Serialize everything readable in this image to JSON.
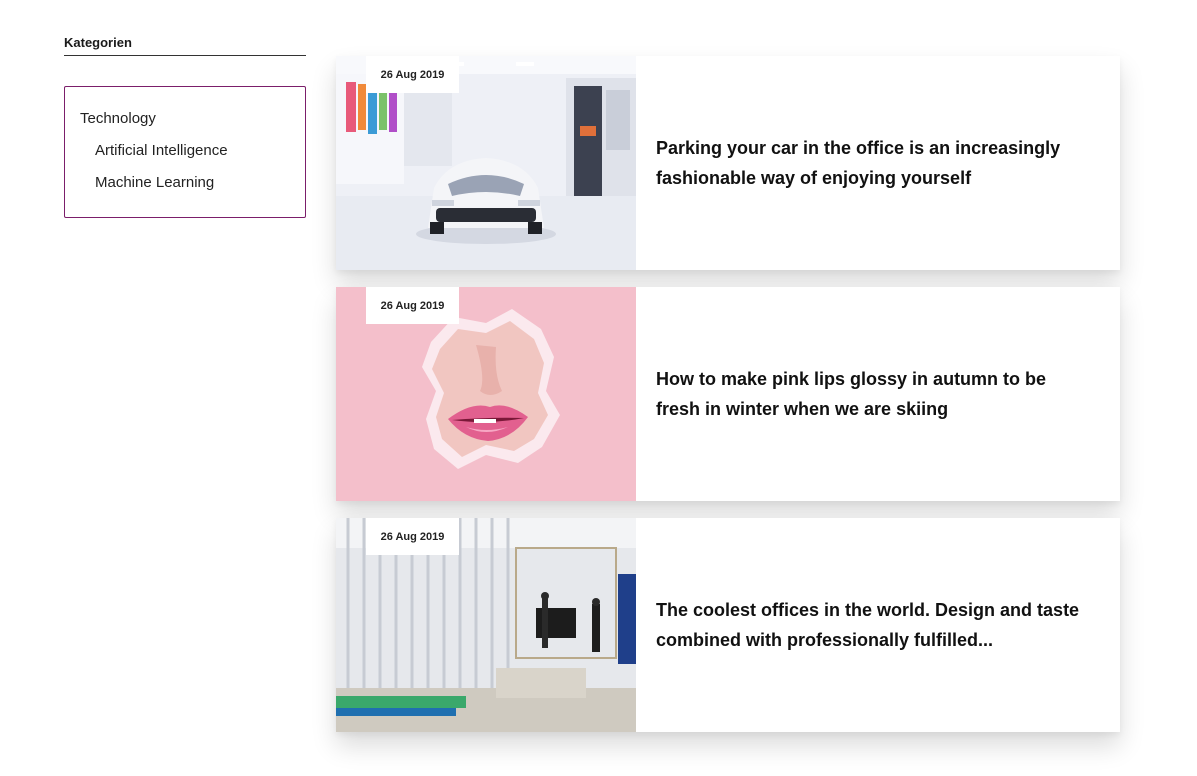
{
  "sidebar": {
    "title": "Kategorien",
    "categories": [
      {
        "label": "Technology",
        "level": 0
      },
      {
        "label": "Artificial Intelligence",
        "level": 1
      },
      {
        "label": "Machine Learning",
        "level": 1
      }
    ]
  },
  "posts": [
    {
      "date": "26 Aug 2019",
      "title": "Parking your car in the office is an increasingly fashionable way of enjoying yourself"
    },
    {
      "date": "26 Aug 2019",
      "title": "How to make pink lips glossy in autumn to be fresh in winter when we are skiing"
    },
    {
      "date": "26 Aug 2019",
      "title": "The coolest offices in the world. Design and taste combined with professionally fulfilled..."
    }
  ],
  "colors": {
    "category_border": "#7b1e6a",
    "pink_background": "#f4bfcb"
  }
}
